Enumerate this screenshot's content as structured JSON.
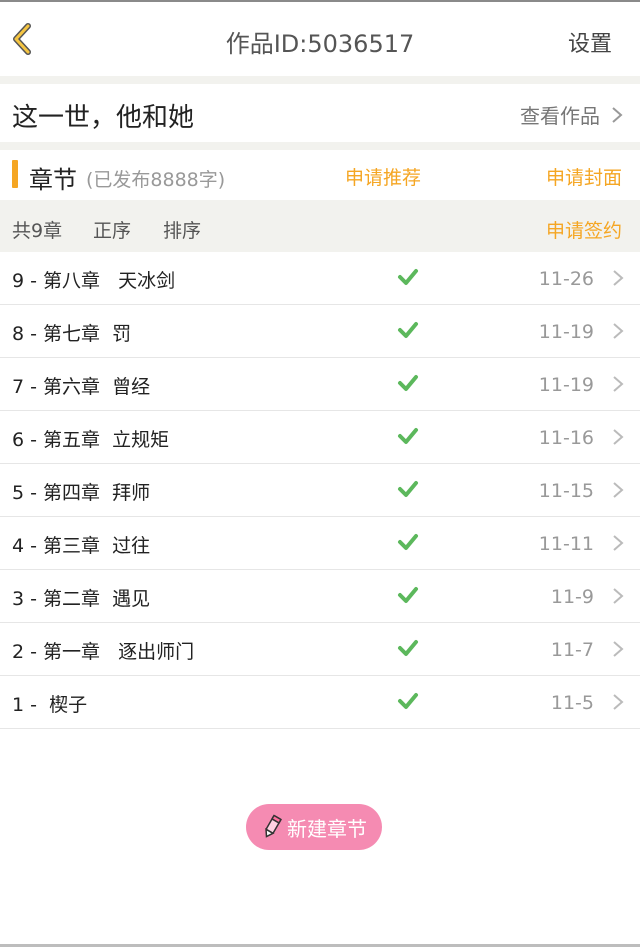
{
  "header": {
    "title": "作品ID:5036517",
    "settings_label": "设置",
    "back_icon": "chevron-left-icon"
  },
  "work": {
    "title": "这一世，他和她",
    "view_label": "查看作品"
  },
  "chapter_section": {
    "label": "章节",
    "published": "(已发布8888字)",
    "apply_recommend": "申请推荐",
    "apply_cover": "申请封面"
  },
  "toolbar": {
    "total": "共9章",
    "asc": "正序",
    "sort": "排序",
    "apply_sign": "申请签约"
  },
  "chapters": [
    {
      "title": "9 - 第八章   天冰剑",
      "date": "11-26",
      "published": true
    },
    {
      "title": "8 - 第七章  罚",
      "date": "11-19",
      "published": true
    },
    {
      "title": "7 - 第六章  曾经",
      "date": "11-19",
      "published": true
    },
    {
      "title": "6 - 第五章  立规矩",
      "date": "11-16",
      "published": true
    },
    {
      "title": "5 - 第四章  拜师",
      "date": "11-15",
      "published": true
    },
    {
      "title": "4 - 第三章  过往",
      "date": "11-11",
      "published": true
    },
    {
      "title": "3 - 第二章  遇见",
      "date": "11-9",
      "published": true
    },
    {
      "title": "2 - 第一章   逐出师门",
      "date": "11-7",
      "published": true
    },
    {
      "title": "1 -  楔子",
      "date": "11-5",
      "published": true
    }
  ],
  "new_chapter": {
    "label": "新建章节",
    "icon": "pencil-icon"
  },
  "colors": {
    "accent": "#f5a623",
    "check": "#5cb85c",
    "button_pink": "#f58bb2"
  }
}
